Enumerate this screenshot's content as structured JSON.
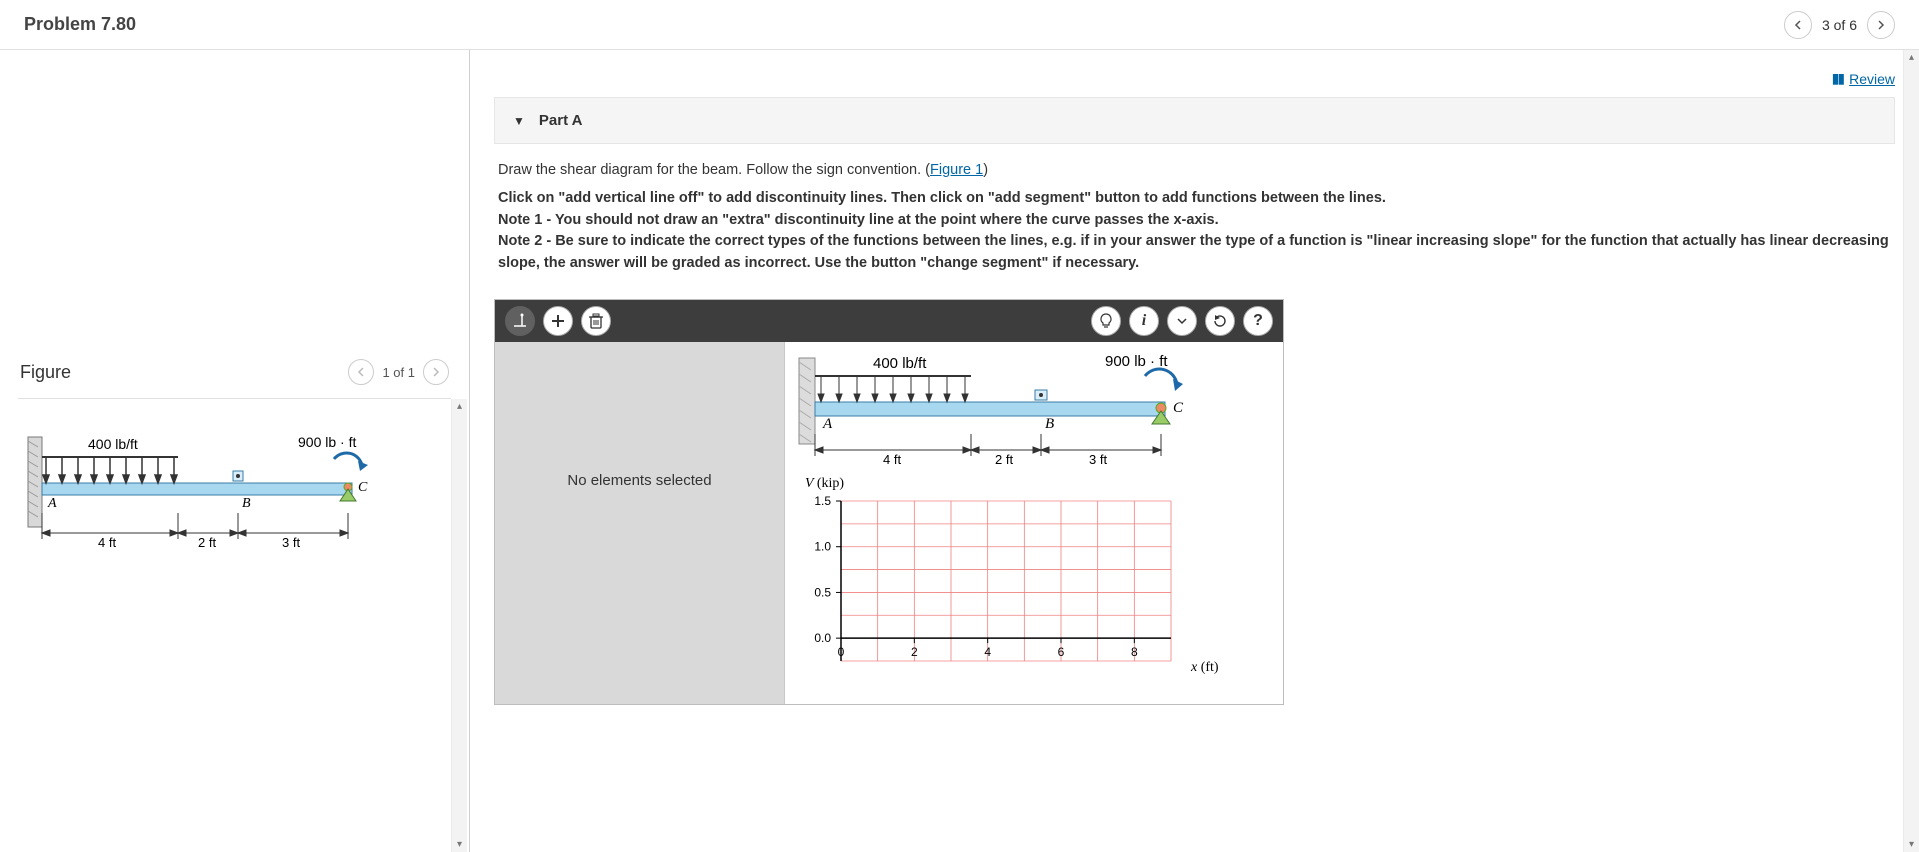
{
  "header": {
    "title": "Problem 7.80",
    "nav_text": "3 of 6"
  },
  "figure_panel": {
    "title": "Figure",
    "nav_text": "1 of 1"
  },
  "beam": {
    "dist_load": "400 lb/ft",
    "moment": "900 lb · ft",
    "ptA": "A",
    "ptB": "B",
    "ptC": "C",
    "dim1": "4 ft",
    "dim2": "2 ft",
    "dim3": "3 ft"
  },
  "review": {
    "label": " Review"
  },
  "part": {
    "label": "Part A",
    "prompt_before": "Draw the shear diagram for the beam. Follow the sign convention. (",
    "prompt_link": "Figure 1",
    "prompt_after": ")",
    "note_intro": "Click on \"add vertical line off\" to add discontinuity lines. Then click on \"add segment\" button to add functions between the lines.",
    "note1": "Note 1 - You should not draw an \"extra\" discontinuity line at the point where the curve passes the x-axis.",
    "note2": "Note 2 - Be sure to indicate the correct types of the functions between the lines, e.g. if in your answer the type of a function is \"linear increasing slope\" for the function that actually has linear decreasing slope, the answer will be graded as incorrect. Use the button \"change segment\" if necessary."
  },
  "widget": {
    "sidebar_text": "No elements selected"
  },
  "chart_data": {
    "type": "line",
    "title": "",
    "xlabel": "x (ft)",
    "ylabel": "V (kip)",
    "x_ticks": [
      0,
      2,
      4,
      6,
      8
    ],
    "y_ticks": [
      0.0,
      0.5,
      1.0,
      1.5
    ],
    "xlim": [
      0,
      9
    ],
    "ylim": [
      -0.25,
      1.5
    ],
    "series": []
  }
}
